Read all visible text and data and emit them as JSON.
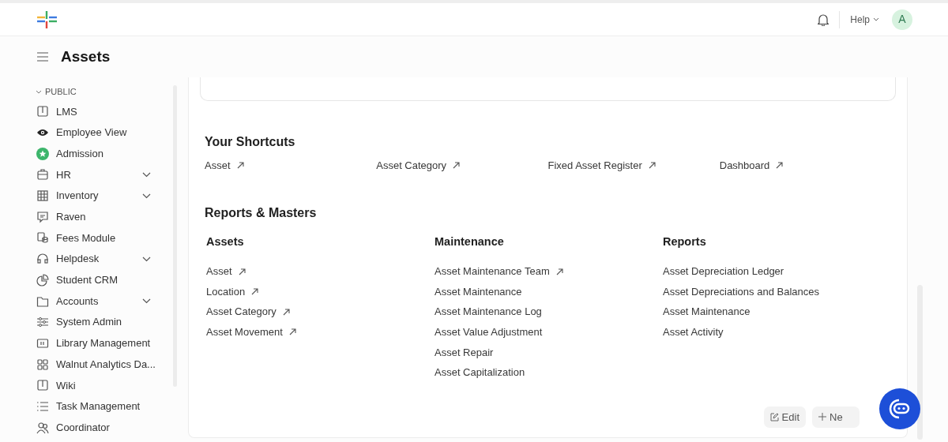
{
  "navbar": {
    "help": "Help",
    "avatar": "A"
  },
  "page": {
    "title": "Assets"
  },
  "sidebar": {
    "section": "PUBLIC",
    "items": [
      {
        "label": "LMS",
        "expandable": false
      },
      {
        "label": "Employee View",
        "expandable": false
      },
      {
        "label": "Admission",
        "expandable": false
      },
      {
        "label": "HR",
        "expandable": true
      },
      {
        "label": "Inventory",
        "expandable": true
      },
      {
        "label": "Raven",
        "expandable": false
      },
      {
        "label": "Fees Module",
        "expandable": false
      },
      {
        "label": "Helpdesk",
        "expandable": true
      },
      {
        "label": "Student CRM",
        "expandable": false
      },
      {
        "label": "Accounts",
        "expandable": true
      },
      {
        "label": "System Admin",
        "expandable": false
      },
      {
        "label": "Library Management",
        "expandable": false
      },
      {
        "label": "Walnut Analytics Da...",
        "expandable": false
      },
      {
        "label": "Wiki",
        "expandable": false
      },
      {
        "label": "Task Management",
        "expandable": false
      },
      {
        "label": "Coordinator",
        "expandable": false
      }
    ]
  },
  "shortcuts": {
    "title": "Your Shortcuts",
    "items": [
      "Asset",
      "Asset Category",
      "Fixed Asset Register",
      "Dashboard"
    ]
  },
  "reports": {
    "title": "Reports & Masters",
    "groups": [
      {
        "title": "Assets",
        "links": [
          {
            "label": "Asset",
            "external": true
          },
          {
            "label": "Location",
            "external": true
          },
          {
            "label": "Asset Category",
            "external": true
          },
          {
            "label": "Asset Movement",
            "external": true
          }
        ]
      },
      {
        "title": "Maintenance",
        "links": [
          {
            "label": "Asset Maintenance Team",
            "external": true
          },
          {
            "label": "Asset Maintenance",
            "external": false
          },
          {
            "label": "Asset Maintenance Log",
            "external": false
          },
          {
            "label": "Asset Value Adjustment",
            "external": false
          },
          {
            "label": "Asset Repair",
            "external": false
          },
          {
            "label": "Asset Capitalization",
            "external": false
          }
        ]
      },
      {
        "title": "Reports",
        "links": [
          {
            "label": "Asset Depreciation Ledger",
            "external": false
          },
          {
            "label": "Asset Depreciations and Balances",
            "external": false
          },
          {
            "label": "Asset Maintenance",
            "external": false
          },
          {
            "label": "Asset Activity",
            "external": false
          }
        ]
      }
    ]
  },
  "actions": {
    "edit": "Edit",
    "new": "Ne"
  }
}
